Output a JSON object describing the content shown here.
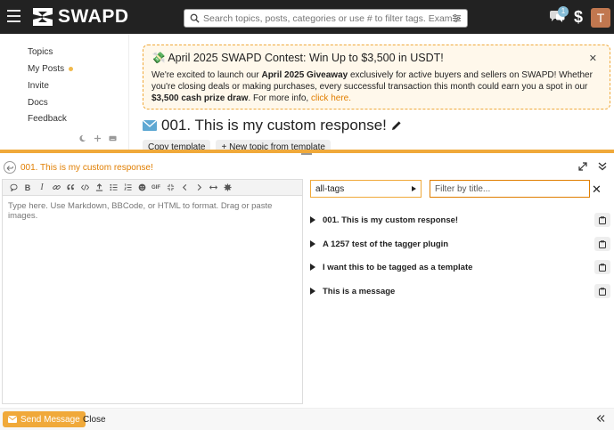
{
  "header": {
    "logo_text": "SWAPD",
    "search_placeholder": "Search topics, posts, categories or use # to filter tags. Example: #prem",
    "notification_count": "1",
    "dollar_label": "$",
    "avatar_letter": "T"
  },
  "sidebar": {
    "items": [
      {
        "label": "Topics"
      },
      {
        "label": "My Posts"
      },
      {
        "label": "Invite"
      },
      {
        "label": "Docs"
      },
      {
        "label": "Feedback"
      }
    ]
  },
  "banner": {
    "title": "💸 April 2025 SWAPD Contest: Win Up to $3,500 in USDT!",
    "body_1": "We're excited to launch our ",
    "body_bold_1": "April 2025 Giveaway",
    "body_2": " exclusively for active buyers and sellers on SWAPD! Whether you're closing deals or making purchases, every successful transaction this month could earn you a spot in our ",
    "body_bold_2": "$3,500 cash prize draw",
    "body_3": ". For more info, ",
    "link": "click here."
  },
  "topic": {
    "title": "001. This is my custom response!",
    "copy_button": "Copy template",
    "new_topic_button": "New topic from template"
  },
  "composer": {
    "reply_title": "001. This is my custom response!",
    "editor_placeholder": "Type here. Use Markdown, BBCode, or HTML to format. Drag or paste images.",
    "tags_select": "all-tags",
    "filter_placeholder": "Filter by title...",
    "templates": [
      {
        "title": "001. This is my custom response!"
      },
      {
        "title": "A 1257 test of the tagger plugin"
      },
      {
        "title": "I want this to be tagged as a template"
      },
      {
        "title": "This is a message"
      }
    ],
    "send_label": "Send Message",
    "close_label": "Close"
  },
  "colors": {
    "accent": "#f0a93a",
    "link": "#e07e00",
    "header_bg": "#222222",
    "banner_bg": "#fff8eb"
  },
  "icons": [
    "hamburger-icon",
    "search-icon",
    "filter-icon",
    "chat-icon",
    "envelope-icon",
    "pencil-icon",
    "copy-icon",
    "reply-icon",
    "expand-icon",
    "collapse-icon"
  ]
}
